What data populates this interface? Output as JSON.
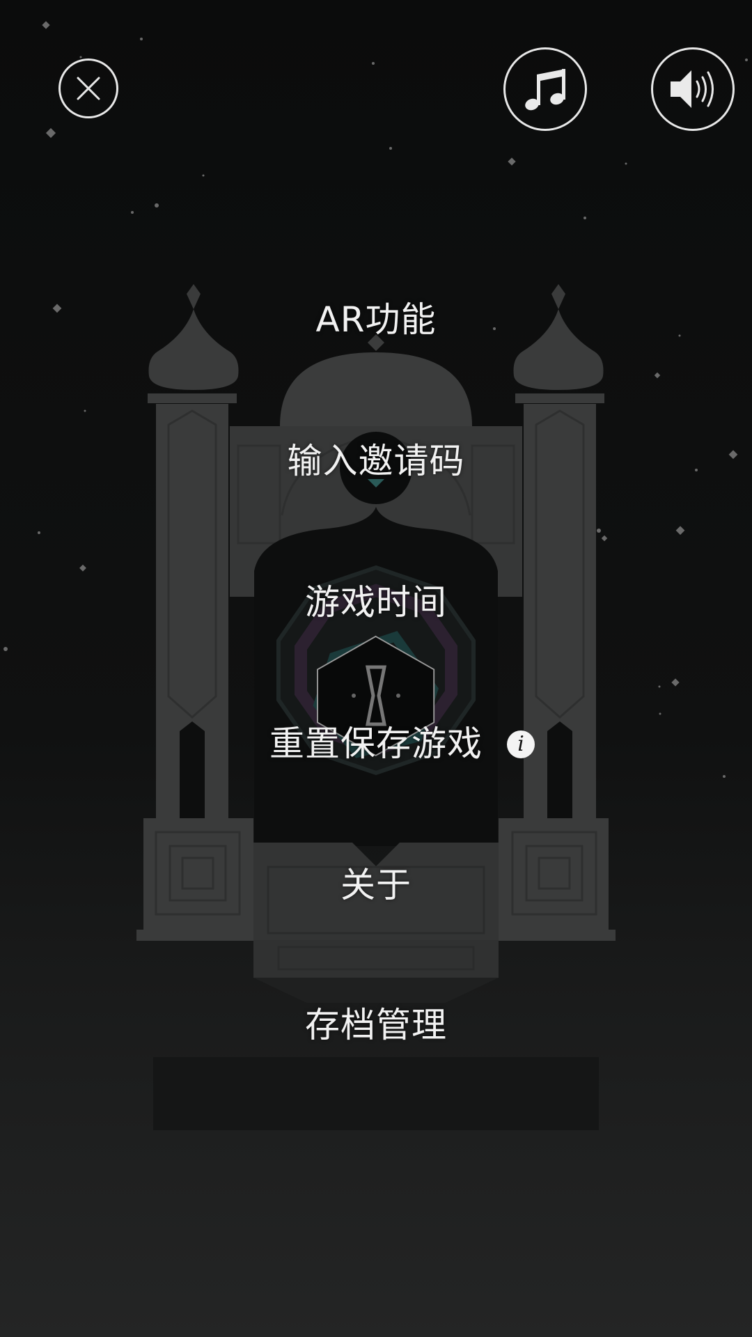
{
  "controls": {
    "close_icon": "close-icon",
    "music_icon": "music-note-icon",
    "sound_icon": "speaker-icon"
  },
  "menu": {
    "items": [
      {
        "label": "AR功能"
      },
      {
        "label": "输入邀请码"
      },
      {
        "label": "游戏时间"
      },
      {
        "label": "重置保存游戏"
      },
      {
        "label": "关于"
      },
      {
        "label": "存档管理"
      }
    ],
    "info_icon_glyph": "i"
  },
  "colors": {
    "background": "#0b0c0c",
    "text": "#f2f2f2",
    "structure": "#3a3b3b",
    "accent_teal": "#1f4a48"
  }
}
